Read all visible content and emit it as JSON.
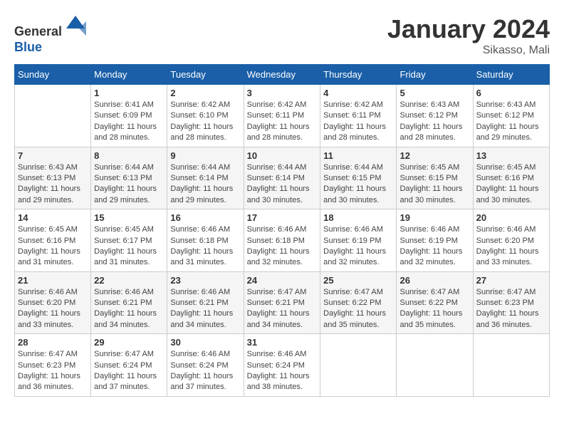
{
  "header": {
    "logo_line1": "General",
    "logo_line2": "Blue",
    "month": "January 2024",
    "location": "Sikasso, Mali"
  },
  "days_of_week": [
    "Sunday",
    "Monday",
    "Tuesday",
    "Wednesday",
    "Thursday",
    "Friday",
    "Saturday"
  ],
  "weeks": [
    [
      {
        "day": "",
        "detail": ""
      },
      {
        "day": "1",
        "detail": "Sunrise: 6:41 AM\nSunset: 6:09 PM\nDaylight: 11 hours\nand 28 minutes."
      },
      {
        "day": "2",
        "detail": "Sunrise: 6:42 AM\nSunset: 6:10 PM\nDaylight: 11 hours\nand 28 minutes."
      },
      {
        "day": "3",
        "detail": "Sunrise: 6:42 AM\nSunset: 6:11 PM\nDaylight: 11 hours\nand 28 minutes."
      },
      {
        "day": "4",
        "detail": "Sunrise: 6:42 AM\nSunset: 6:11 PM\nDaylight: 11 hours\nand 28 minutes."
      },
      {
        "day": "5",
        "detail": "Sunrise: 6:43 AM\nSunset: 6:12 PM\nDaylight: 11 hours\nand 28 minutes."
      },
      {
        "day": "6",
        "detail": "Sunrise: 6:43 AM\nSunset: 6:12 PM\nDaylight: 11 hours\nand 29 minutes."
      }
    ],
    [
      {
        "day": "7",
        "detail": "Sunrise: 6:43 AM\nSunset: 6:13 PM\nDaylight: 11 hours\nand 29 minutes."
      },
      {
        "day": "8",
        "detail": "Sunrise: 6:44 AM\nSunset: 6:13 PM\nDaylight: 11 hours\nand 29 minutes."
      },
      {
        "day": "9",
        "detail": "Sunrise: 6:44 AM\nSunset: 6:14 PM\nDaylight: 11 hours\nand 29 minutes."
      },
      {
        "day": "10",
        "detail": "Sunrise: 6:44 AM\nSunset: 6:14 PM\nDaylight: 11 hours\nand 30 minutes."
      },
      {
        "day": "11",
        "detail": "Sunrise: 6:44 AM\nSunset: 6:15 PM\nDaylight: 11 hours\nand 30 minutes."
      },
      {
        "day": "12",
        "detail": "Sunrise: 6:45 AM\nSunset: 6:15 PM\nDaylight: 11 hours\nand 30 minutes."
      },
      {
        "day": "13",
        "detail": "Sunrise: 6:45 AM\nSunset: 6:16 PM\nDaylight: 11 hours\nand 30 minutes."
      }
    ],
    [
      {
        "day": "14",
        "detail": "Sunrise: 6:45 AM\nSunset: 6:16 PM\nDaylight: 11 hours\nand 31 minutes."
      },
      {
        "day": "15",
        "detail": "Sunrise: 6:45 AM\nSunset: 6:17 PM\nDaylight: 11 hours\nand 31 minutes."
      },
      {
        "day": "16",
        "detail": "Sunrise: 6:46 AM\nSunset: 6:18 PM\nDaylight: 11 hours\nand 31 minutes."
      },
      {
        "day": "17",
        "detail": "Sunrise: 6:46 AM\nSunset: 6:18 PM\nDaylight: 11 hours\nand 32 minutes."
      },
      {
        "day": "18",
        "detail": "Sunrise: 6:46 AM\nSunset: 6:19 PM\nDaylight: 11 hours\nand 32 minutes."
      },
      {
        "day": "19",
        "detail": "Sunrise: 6:46 AM\nSunset: 6:19 PM\nDaylight: 11 hours\nand 32 minutes."
      },
      {
        "day": "20",
        "detail": "Sunrise: 6:46 AM\nSunset: 6:20 PM\nDaylight: 11 hours\nand 33 minutes."
      }
    ],
    [
      {
        "day": "21",
        "detail": "Sunrise: 6:46 AM\nSunset: 6:20 PM\nDaylight: 11 hours\nand 33 minutes."
      },
      {
        "day": "22",
        "detail": "Sunrise: 6:46 AM\nSunset: 6:21 PM\nDaylight: 11 hours\nand 34 minutes."
      },
      {
        "day": "23",
        "detail": "Sunrise: 6:46 AM\nSunset: 6:21 PM\nDaylight: 11 hours\nand 34 minutes."
      },
      {
        "day": "24",
        "detail": "Sunrise: 6:47 AM\nSunset: 6:21 PM\nDaylight: 11 hours\nand 34 minutes."
      },
      {
        "day": "25",
        "detail": "Sunrise: 6:47 AM\nSunset: 6:22 PM\nDaylight: 11 hours\nand 35 minutes."
      },
      {
        "day": "26",
        "detail": "Sunrise: 6:47 AM\nSunset: 6:22 PM\nDaylight: 11 hours\nand 35 minutes."
      },
      {
        "day": "27",
        "detail": "Sunrise: 6:47 AM\nSunset: 6:23 PM\nDaylight: 11 hours\nand 36 minutes."
      }
    ],
    [
      {
        "day": "28",
        "detail": "Sunrise: 6:47 AM\nSunset: 6:23 PM\nDaylight: 11 hours\nand 36 minutes."
      },
      {
        "day": "29",
        "detail": "Sunrise: 6:47 AM\nSunset: 6:24 PM\nDaylight: 11 hours\nand 37 minutes."
      },
      {
        "day": "30",
        "detail": "Sunrise: 6:46 AM\nSunset: 6:24 PM\nDaylight: 11 hours\nand 37 minutes."
      },
      {
        "day": "31",
        "detail": "Sunrise: 6:46 AM\nSunset: 6:24 PM\nDaylight: 11 hours\nand 38 minutes."
      },
      {
        "day": "",
        "detail": ""
      },
      {
        "day": "",
        "detail": ""
      },
      {
        "day": "",
        "detail": ""
      }
    ]
  ]
}
